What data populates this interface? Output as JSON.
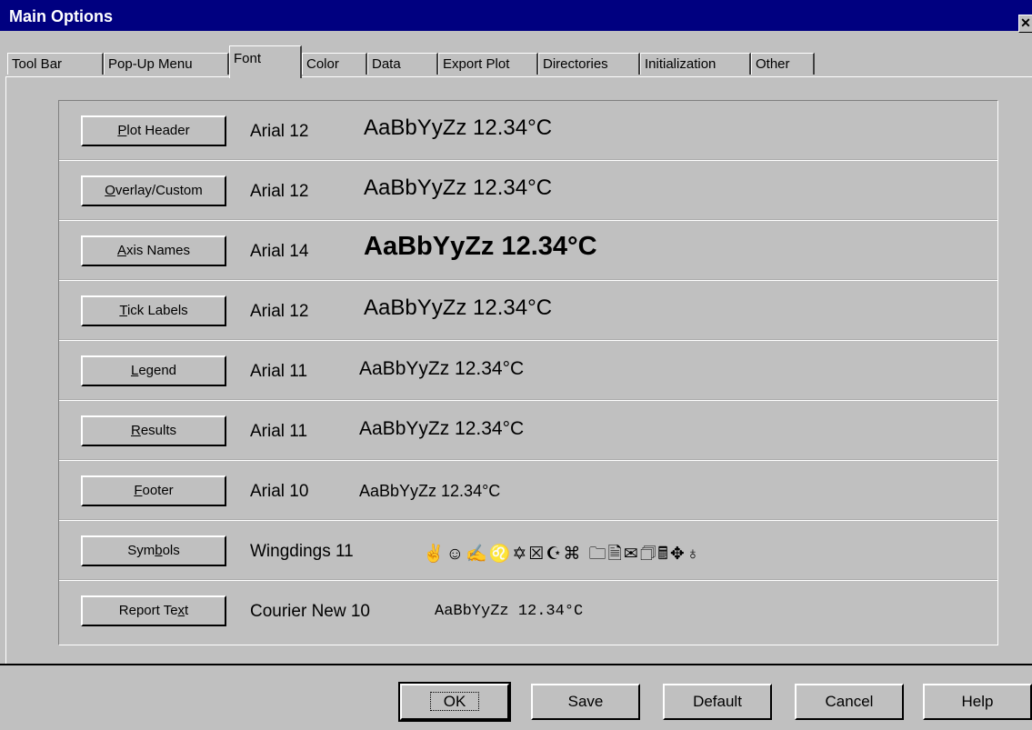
{
  "window": {
    "title": "Main Options",
    "close_glyph": "✕"
  },
  "tabs": [
    {
      "label": "Tool Bar"
    },
    {
      "label": "Pop-Up Menu"
    },
    {
      "label": "Font"
    },
    {
      "label": "Color"
    },
    {
      "label": "Data"
    },
    {
      "label": "Export Plot"
    },
    {
      "label": "Directories"
    },
    {
      "label": "Initialization"
    },
    {
      "label": "Other"
    }
  ],
  "active_tab": "Font",
  "rows": [
    {
      "button": "Plot Header",
      "mnemonic": "P",
      "font": "Arial 12",
      "sample": "AaBbYyZz 12.34°C"
    },
    {
      "button": "Overlay/Custom",
      "mnemonic": "O",
      "font": "Arial 12",
      "sample": "AaBbYyZz 12.34°C"
    },
    {
      "button": "Axis Names",
      "mnemonic": "A",
      "font": "Arial 14",
      "sample": "AaBbYyZz 12.34°C"
    },
    {
      "button": "Tick Labels",
      "mnemonic": "T",
      "font": "Arial 12",
      "sample": "AaBbYyZz 12.34°C"
    },
    {
      "button": "Legend",
      "mnemonic": "L",
      "font": "Arial 11",
      "sample": "AaBbYyZz 12.34°C"
    },
    {
      "button": "Results",
      "mnemonic": "R",
      "font": "Arial 11",
      "sample": "AaBbYyZz 12.34°C"
    },
    {
      "button": "Footer",
      "mnemonic": "F",
      "font": "Arial 10",
      "sample": "AaBbYyZz 12.34°C"
    },
    {
      "button": "Symbols",
      "mnemonic": "b",
      "font": "Wingdings 11",
      "sample": "✌☺✍♌✡☒☪⌘ 🗀🗎✉🗇🖩✥♁"
    },
    {
      "button": "Report Text",
      "mnemonic": "x",
      "font": "Courier New 10",
      "sample": "AaBbYyZz 12.34°C"
    }
  ],
  "footer_buttons": [
    {
      "label": "OK"
    },
    {
      "label": "Save"
    },
    {
      "label": "Default"
    },
    {
      "label": "Cancel"
    },
    {
      "label": "Help"
    }
  ]
}
